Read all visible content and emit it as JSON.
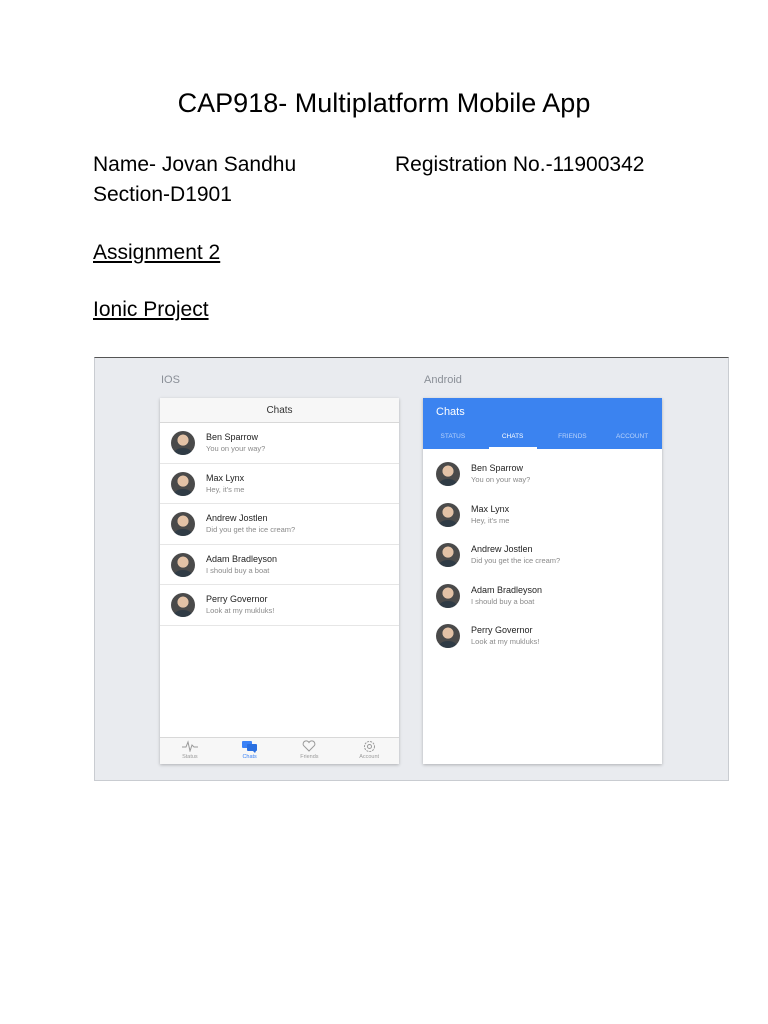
{
  "document": {
    "title": "CAP918- Multiplatform Mobile App",
    "name_line": "Name- Jovan Sandhu",
    "registration_line": "Registration No.-11900342",
    "section_line": "Section-D1901",
    "assignment": "Assignment 2",
    "project": "Ionic Project"
  },
  "figure": {
    "ios_label": "IOS",
    "android_label": "Android",
    "accent_color": "#3b83f0",
    "ios": {
      "header_title": "Chats",
      "tabs": [
        {
          "label": "Status",
          "icon": "pulse-icon"
        },
        {
          "label": "Chats",
          "icon": "chat-bubbles-icon"
        },
        {
          "label": "Friends",
          "icon": "heart-icon"
        },
        {
          "label": "Account",
          "icon": "gear-icon"
        }
      ],
      "active_tab": "Chats"
    },
    "android": {
      "toolbar_title": "Chats",
      "tabs": [
        "STATUS",
        "CHATS",
        "FRIENDS",
        "ACCOUNT"
      ],
      "active_tab": "CHATS"
    },
    "chats": [
      {
        "name": "Ben Sparrow",
        "message": "You on your way?"
      },
      {
        "name": "Max Lynx",
        "message": "Hey, it's me"
      },
      {
        "name": "Andrew Jostlen",
        "message": "Did you get the ice cream?"
      },
      {
        "name": "Adam Bradleyson",
        "message": "I should buy a boat"
      },
      {
        "name": "Perry Governor",
        "message": "Look at my mukluks!"
      }
    ]
  }
}
